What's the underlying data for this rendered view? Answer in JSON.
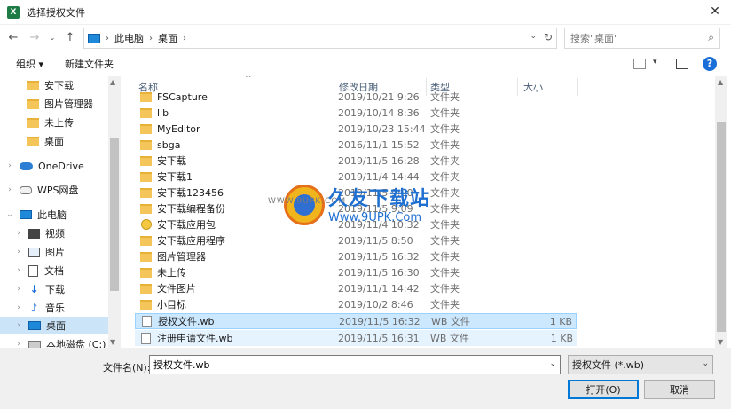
{
  "window": {
    "title": "选择授权文件",
    "app_icon_letter": "X"
  },
  "address": {
    "crumbs": [
      "此电脑",
      "桌面"
    ],
    "search_placeholder": "搜索\"桌面\""
  },
  "toolbar": {
    "organize": "组织 ▾",
    "new_folder": "新建文件夹"
  },
  "nav": [
    {
      "label": "安下载",
      "icon": "folder-icon"
    },
    {
      "label": "图片管理器",
      "icon": "folder-icon"
    },
    {
      "label": "未上传",
      "icon": "folder-icon"
    },
    {
      "label": "桌面",
      "icon": "folder-icon"
    },
    {
      "label": "OneDrive",
      "icon": "cloud-icon"
    },
    {
      "label": "WPS网盘",
      "icon": "wps-cloud-icon"
    },
    {
      "label": "此电脑",
      "icon": "computer-icon"
    },
    {
      "label": "视频",
      "icon": "video-icon"
    },
    {
      "label": "图片",
      "icon": "picture-icon"
    },
    {
      "label": "文档",
      "icon": "document-icon"
    },
    {
      "label": "下载",
      "icon": "download-icon"
    },
    {
      "label": "音乐",
      "icon": "music-icon"
    },
    {
      "label": "桌面",
      "icon": "desktop-icon"
    },
    {
      "label": "本地磁盘 (C:)",
      "icon": "disk-icon"
    }
  ],
  "columns": {
    "name": "名称",
    "date": "修改日期",
    "type": "类型",
    "size": "大小"
  },
  "files": [
    {
      "name": "FSCapture",
      "date": "2019/10/21 9:26",
      "type": "文件夹",
      "size": ""
    },
    {
      "name": "lib",
      "date": "2019/10/14 8:36",
      "type": "文件夹",
      "size": ""
    },
    {
      "name": "MyEditor",
      "date": "2019/10/23 15:44",
      "type": "文件夹",
      "size": ""
    },
    {
      "name": "sbga",
      "date": "2016/11/1 15:52",
      "type": "文件夹",
      "size": ""
    },
    {
      "name": "安下载",
      "date": "2019/11/5 16:28",
      "type": "文件夹",
      "size": ""
    },
    {
      "name": "安下载1",
      "date": "2019/11/4 14:44",
      "type": "文件夹",
      "size": ""
    },
    {
      "name": "安下载123456",
      "date": "2019/11/5 9:00",
      "type": "文件夹",
      "size": ""
    },
    {
      "name": "安下载编程备份",
      "date": "2019/11/5 9:09",
      "type": "文件夹",
      "size": ""
    },
    {
      "name": "安下载应用包",
      "date": "2019/11/4 10:32",
      "type": "文件夹",
      "size": ""
    },
    {
      "name": "安下载应用程序",
      "date": "2019/11/5 8:50",
      "type": "文件夹",
      "size": ""
    },
    {
      "name": "图片管理器",
      "date": "2019/11/5 16:32",
      "type": "文件夹",
      "size": ""
    },
    {
      "name": "未上传",
      "date": "2019/11/5 16:30",
      "type": "文件夹",
      "size": ""
    },
    {
      "name": "文件图片",
      "date": "2019/11/1 14:42",
      "type": "文件夹",
      "size": ""
    },
    {
      "name": "小目标",
      "date": "2019/10/2 8:46",
      "type": "文件夹",
      "size": ""
    },
    {
      "name": "授权文件.wb",
      "date": "2019/11/5 16:32",
      "type": "WB 文件",
      "size": "1 KB"
    },
    {
      "name": "注册申请文件.wb",
      "date": "2019/11/5 16:31",
      "type": "WB 文件",
      "size": "1 KB"
    }
  ],
  "watermark": {
    "title": "久友下载站",
    "url": "Www.9UPK.Com",
    "url_small": "WWW.9UPK.COM"
  },
  "bottom": {
    "filename_label": "文件名(N):",
    "filename_value": "授权文件.wb",
    "filetype": "授权文件 (*.wb)",
    "open_label": "打开(O)",
    "cancel_label": "取消"
  }
}
